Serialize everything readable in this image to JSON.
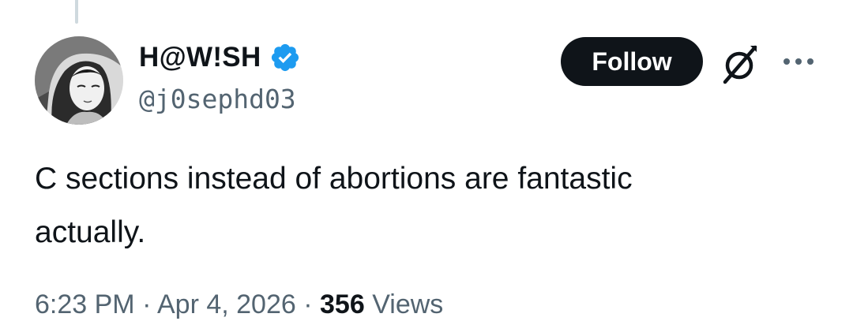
{
  "author": {
    "display_name": "H@W!SH",
    "handle": "@j0sephd03",
    "verified": true
  },
  "actions": {
    "follow_label": "Follow"
  },
  "tweet": {
    "lines": [
      "C sections instead of abortions are fantastic",
      "actually."
    ]
  },
  "meta": {
    "time": "6:23 PM",
    "separator": "·",
    "date": "Apr 4, 2026",
    "views_count": "356",
    "views_label": "Views"
  },
  "icons": {
    "verified": "verified-badge-icon",
    "grok": "grok-icon",
    "more": "more-options-icon"
  },
  "colors": {
    "verified_blue": "#1d9bf0",
    "text_primary": "#0f1419",
    "text_secondary": "#536471",
    "thread_line": "#cfd9de"
  }
}
